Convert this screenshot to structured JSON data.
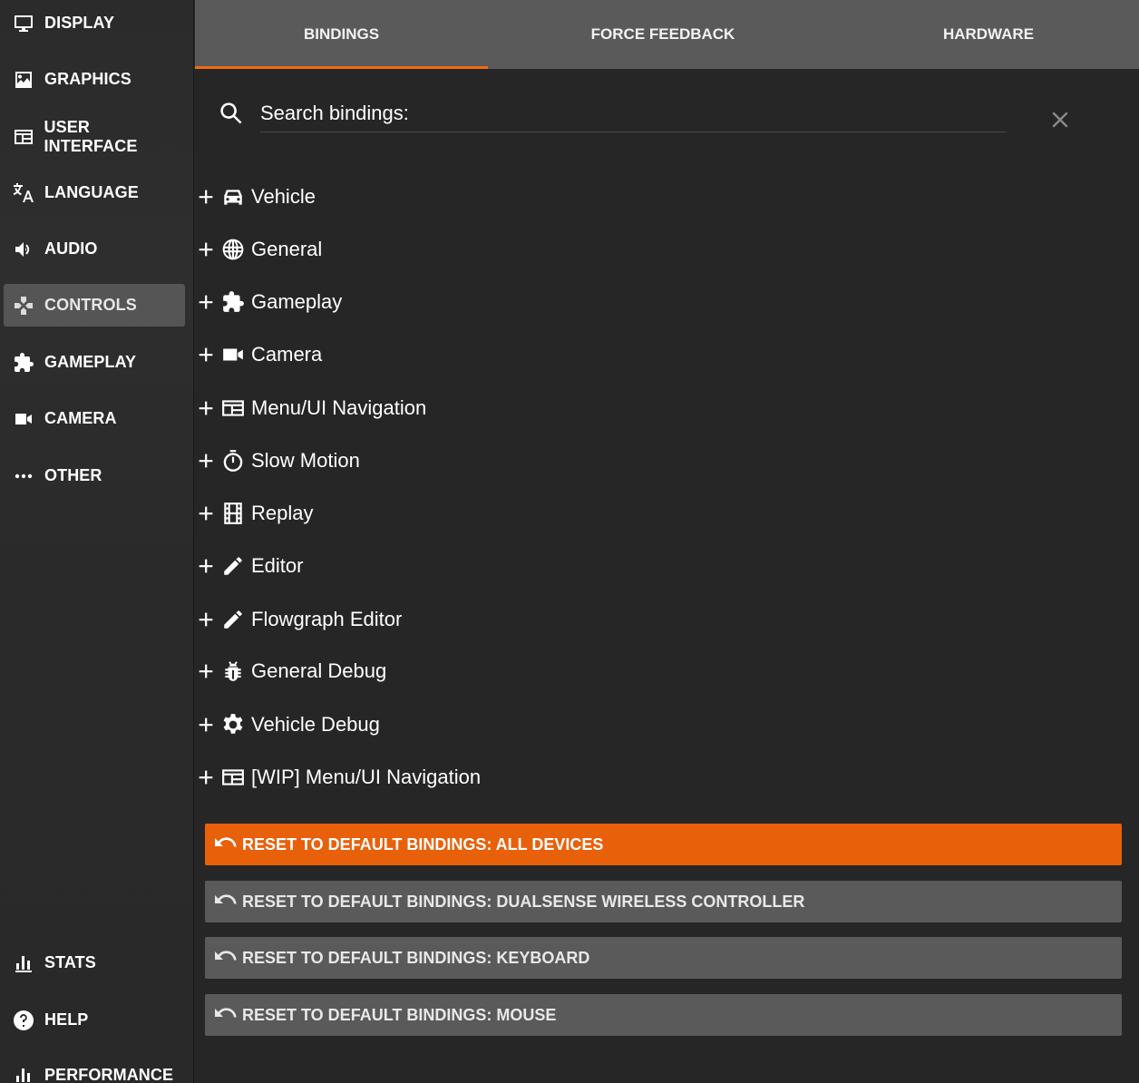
{
  "sidebar": {
    "items": [
      {
        "label": "DISPLAY",
        "icon": "monitor-icon"
      },
      {
        "label": "GRAPHICS",
        "icon": "image-icon"
      },
      {
        "label": "USER INTERFACE",
        "icon": "window-icon"
      },
      {
        "label": "LANGUAGE",
        "icon": "translate-icon"
      },
      {
        "label": "AUDIO",
        "icon": "speaker-icon"
      },
      {
        "label": "CONTROLS",
        "icon": "gamepad-icon",
        "active": true
      },
      {
        "label": "GAMEPLAY",
        "icon": "puzzle-icon"
      },
      {
        "label": "CAMERA",
        "icon": "video-camera-icon"
      },
      {
        "label": "OTHER",
        "icon": "ellipsis-icon"
      }
    ],
    "bottom_items": [
      {
        "label": "STATS",
        "icon": "bar-chart-icon"
      },
      {
        "label": "HELP",
        "icon": "help-icon"
      },
      {
        "label": "PERFORMANCE",
        "icon": "bar-chart-icon"
      }
    ]
  },
  "tabs": [
    {
      "label": "BINDINGS",
      "active": true
    },
    {
      "label": "FORCE FEEDBACK"
    },
    {
      "label": "HARDWARE"
    }
  ],
  "search": {
    "placeholder": "Search bindings:",
    "value": ""
  },
  "categories": [
    {
      "label": "Vehicle",
      "icon": "car-icon"
    },
    {
      "label": "General",
      "icon": "globe-icon"
    },
    {
      "label": "Gameplay",
      "icon": "puzzle-icon"
    },
    {
      "label": "Camera",
      "icon": "video-camera-icon"
    },
    {
      "label": "Menu/UI Navigation",
      "icon": "window-icon"
    },
    {
      "label": "Slow Motion",
      "icon": "stopwatch-icon"
    },
    {
      "label": "Replay",
      "icon": "film-icon"
    },
    {
      "label": "Editor",
      "icon": "pencil-icon"
    },
    {
      "label": "Flowgraph Editor",
      "icon": "pencil-icon"
    },
    {
      "label": "General Debug",
      "icon": "bug-icon"
    },
    {
      "label": "Vehicle Debug",
      "icon": "gear-icon"
    },
    {
      "label": "[WIP] Menu/UI Navigation",
      "icon": "window-icon"
    }
  ],
  "reset_buttons": [
    {
      "label": "RESET TO DEFAULT BINDINGS: ALL DEVICES",
      "primary": true
    },
    {
      "label": "RESET TO DEFAULT BINDINGS: DUALSENSE WIRELESS CONTROLLER"
    },
    {
      "label": "RESET TO DEFAULT BINDINGS: KEYBOARD"
    },
    {
      "label": "RESET TO DEFAULT BINDINGS: MOUSE"
    }
  ],
  "colors": {
    "accent": "#e8600a",
    "tab_underline": "#f26b0f",
    "panel_bg": "#262626",
    "tab_bar_bg": "#5a5a5a",
    "button_bg": "#5a5a5a"
  }
}
